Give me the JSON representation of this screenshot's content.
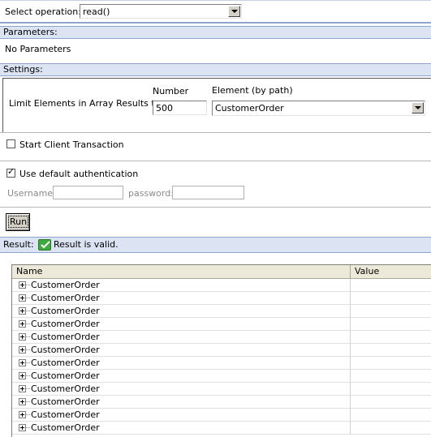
{
  "operation": {
    "label": "Select operation:",
    "value": "read()"
  },
  "parameters": {
    "header": "Parameters:",
    "text": "No Parameters"
  },
  "settings": {
    "header": "Settings:",
    "limit_label": "Limit Elements in Array Results to:",
    "number_label": "Number",
    "number_value": "500",
    "element_label": "Element (by path)",
    "element_value": "CustomerOrder"
  },
  "transaction": {
    "label": "Start Client Transaction",
    "checked": false
  },
  "auth": {
    "label": "Use default authentication",
    "checked": true,
    "username_label": "Username:",
    "username_value": "",
    "password_label": "password:",
    "password_value": ""
  },
  "run_button": "Run",
  "result": {
    "label": "Result:",
    "status": "Result is valid.",
    "icon": "valid-check-icon",
    "columns": [
      "Name",
      "Value"
    ],
    "rows": [
      "CustomerOrder",
      "CustomerOrder",
      "CustomerOrder",
      "CustomerOrder",
      "CustomerOrder",
      "CustomerOrder",
      "CustomerOrder",
      "CustomerOrder",
      "CustomerOrder",
      "CustomerOrder",
      "CustomerOrder",
      "CustomerOrder"
    ]
  },
  "colors": {
    "header_band": "#dce4f4",
    "header_border": "#8ea4cc",
    "valid_green": "#3fa83f"
  }
}
